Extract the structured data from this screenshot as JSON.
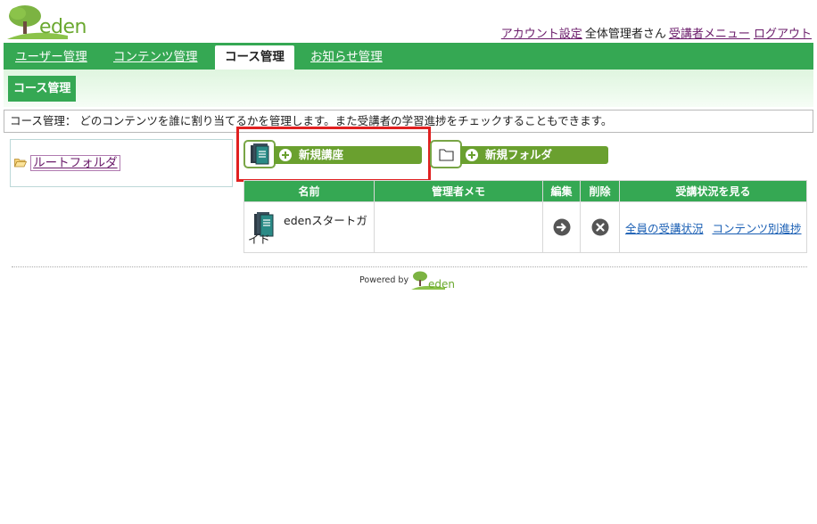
{
  "header": {
    "logo_text": "eden",
    "account_settings": "アカウント設定",
    "user_name": "全体管理者さん",
    "learner_menu": "受講者メニュー",
    "logout": "ログアウト"
  },
  "nav": {
    "tabs": [
      {
        "label": "ユーザー管理"
      },
      {
        "label": "コンテンツ管理"
      },
      {
        "label": "コース管理"
      },
      {
        "label": "お知らせ管理"
      }
    ],
    "active_index": 2
  },
  "subnav": {
    "label": "コース管理"
  },
  "description": "コース管理： どのコンテンツを誰に割り当てるかを管理します。また受講者の学習進捗をチェックすることもできます。",
  "tree": {
    "root_label": "ルートフォルダ"
  },
  "actions": {
    "new_course": "新規講座",
    "new_folder": "新規フォルダ"
  },
  "table": {
    "headers": [
      "名前",
      "管理者メモ",
      "編集",
      "削除",
      "受講状況を見る"
    ],
    "rows": [
      {
        "name": "edenスタートガイド",
        "memo": "",
        "status_all": "全員の受講状況",
        "status_by_content": "コンテンツ別進捗"
      }
    ]
  },
  "footer": {
    "powered_by": "Powered by",
    "logo_text": "eden"
  },
  "colors": {
    "brand_green": "#35a853",
    "button_green": "#6aa02f",
    "highlight_red": "#e02020",
    "visited_link": "#6a1b6a",
    "link_blue": "#1a5fb4"
  }
}
